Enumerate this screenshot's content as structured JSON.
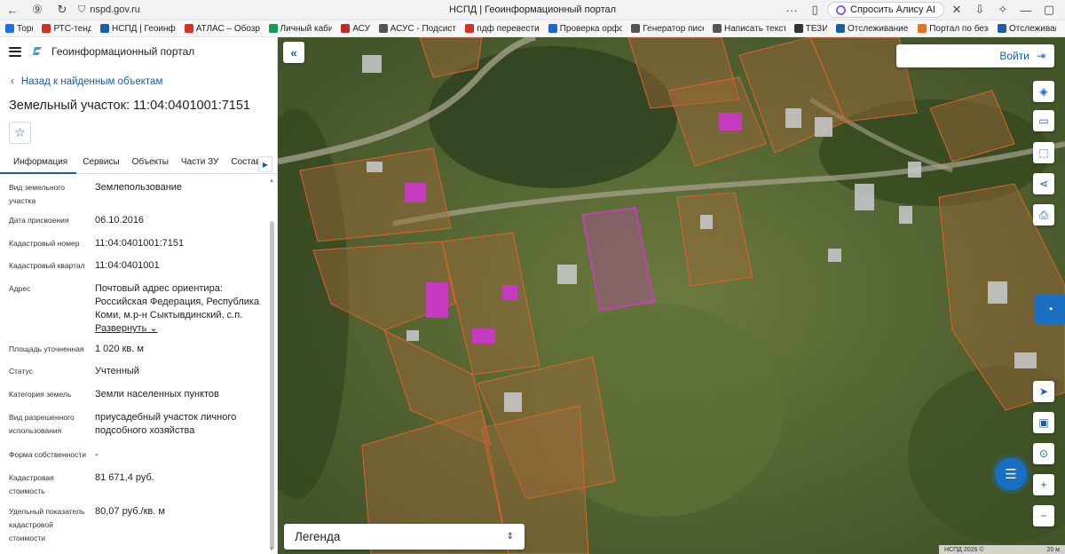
{
  "browser": {
    "url": "nspd.gov.ru",
    "tab_title": "НСПД | Геоинформационный портал",
    "alice_label": "Спросить Алису AI",
    "bookmarks": [
      {
        "label": "Торги",
        "color": "#1a73e8"
      },
      {
        "label": "РТС-тендер",
        "color": "#d93025"
      },
      {
        "label": "НСПД | Геоинфор...",
        "color": "#1a5dab"
      },
      {
        "label": "АТЛАС – Обозрев...",
        "color": "#d93025"
      },
      {
        "label": "Личный кабинет",
        "color": "#0f9d58"
      },
      {
        "label": "АСУС",
        "color": "#c62828"
      },
      {
        "label": "АСУС - Подсистем...",
        "color": "#555555"
      },
      {
        "label": "пдф перевести в ...",
        "color": "#d93025"
      },
      {
        "label": "Проверка орфогр...",
        "color": "#1e63d8"
      },
      {
        "label": "Генератор писем...",
        "color": "#555555"
      },
      {
        "label": "Написать текст о...",
        "color": "#555555"
      },
      {
        "label": "ТЕЗИС",
        "color": "#333333"
      },
      {
        "label": "Отслеживание от...",
        "color": "#1a5dab"
      },
      {
        "label": "Портал по безоп...",
        "color": "#e8711a"
      },
      {
        "label": "Отслеживание",
        "color": "#1a5dab"
      }
    ]
  },
  "panel": {
    "app_title": "Геоинформационный портал",
    "back_label": "Назад к найденным объектам",
    "plot_title": "Земельный участок: 11:04:0401001:7151",
    "tabs": [
      "Информация",
      "Сервисы",
      "Объекты",
      "Части ЗУ",
      "Состав"
    ],
    "expand_label": "Развернуть",
    "rows": [
      {
        "label": "Вид земельного участка",
        "value": "Землепользование"
      },
      {
        "label": "Дата присвоения",
        "value": "06.10.2016"
      },
      {
        "label": "Кадастровый номер",
        "value": "11:04:0401001:7151"
      },
      {
        "label": "Кадастровый квартал",
        "value": "11:04:0401001"
      },
      {
        "label": "Адрес",
        "value": "Почтовый адрес ориентира: Российская Федерация, Республика Коми, м.р-н Сыктывдинский, с.п."
      },
      {
        "label": "Площадь уточненная",
        "value": "1 020 кв. м"
      },
      {
        "label": "Статус",
        "value": "Учтенный"
      },
      {
        "label": "Категория земель",
        "value": "Земли населенных пунктов"
      },
      {
        "label": "Вид разрешенного использования",
        "value": "приусадебный участок личного подсобного хозяйства"
      },
      {
        "label": "Форма собственности",
        "value": "-"
      },
      {
        "label": "Кадастровая стоимость",
        "value": "81 671,4 руб."
      },
      {
        "label": "Удельный показатель кадастровой стоимости",
        "value": "80,07 руб./кв. м"
      }
    ]
  },
  "map": {
    "login_label": "Войти",
    "legend_label": "Легенда",
    "attribution": "НСПД 2026 ©",
    "scale": "20 м"
  }
}
